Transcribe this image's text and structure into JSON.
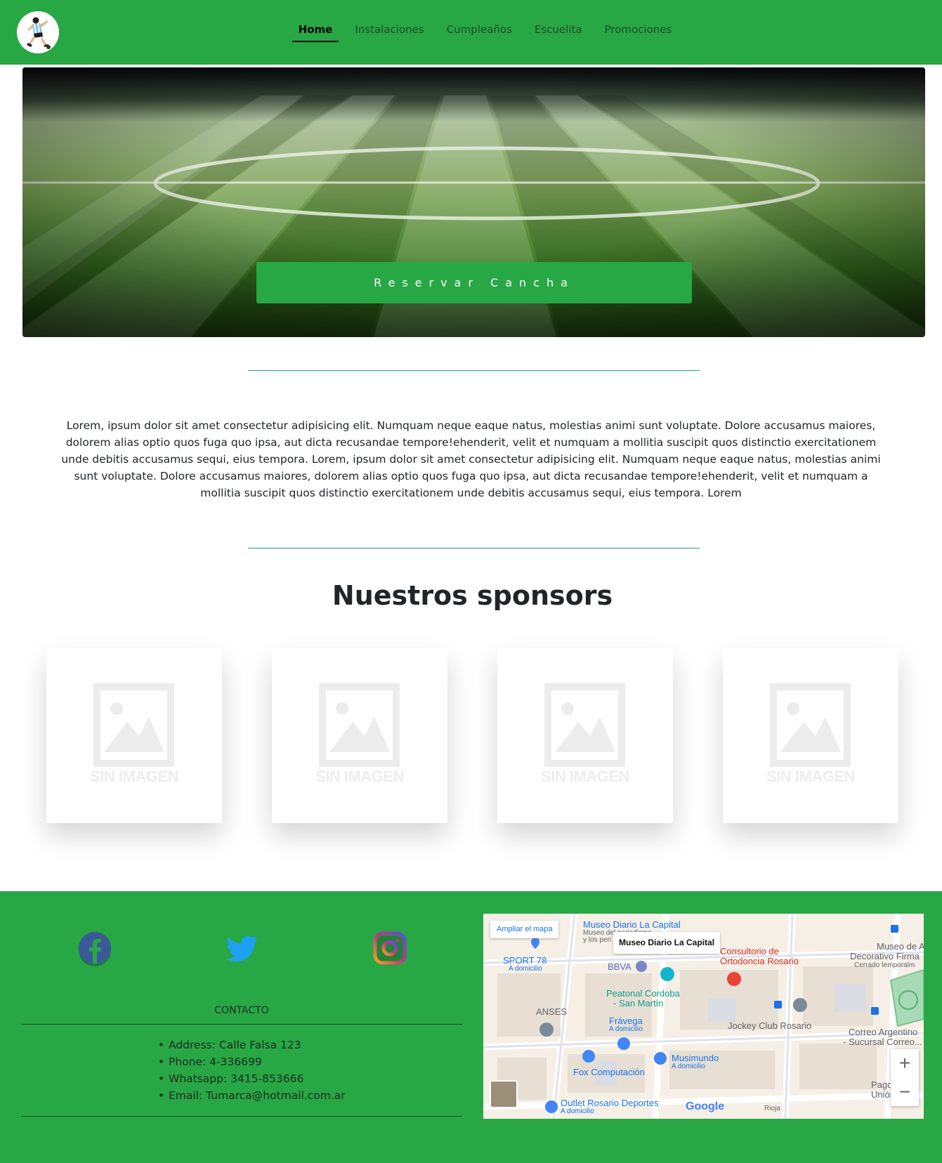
{
  "nav": {
    "items": [
      {
        "label": "Home",
        "active": true
      },
      {
        "label": "Instalaciones",
        "active": false
      },
      {
        "label": "Cumpleaños",
        "active": false
      },
      {
        "label": "Escuelita",
        "active": false
      },
      {
        "label": "Promociones",
        "active": false
      }
    ]
  },
  "hero": {
    "button_label": "Reservar Cancha"
  },
  "intro": {
    "text": "Lorem, ipsum dolor sit amet consectetur adipisicing elit. Numquam neque eaque natus, molestias animi sunt voluptate. Dolore accusamus maiores, dolorem alias optio quos fuga quo ipsa, aut dicta recusandae tempore!ehenderit, velit et numquam a mollitia suscipit quos distinctio exercitationem unde debitis accusamus sequi, eius tempora. Lorem, ipsum dolor sit amet consectetur adipisicing elit. Numquam neque eaque natus, molestias animi sunt voluptate. Dolore accusamus maiores, dolorem alias optio quos fuga quo ipsa, aut dicta recusandae tempore!ehenderit, velit et numquam a mollitia suscipit quos distinctio exercitationem unde debitis accusamus sequi, eius tempora. Lorem"
  },
  "sponsors": {
    "title": "Nuestros sponsors",
    "placeholder_text": "SIN IMAGEN"
  },
  "footer": {
    "social": [
      "facebook-icon",
      "twitter-icon",
      "instagram-icon"
    ],
    "contact_title": "CONTACTO",
    "contact": {
      "address": "Address: Calle Falsa 123",
      "phone": "Phone: 4-336699",
      "whatsapp": "Whatsapp: 3415-853666",
      "email": "Email: Tumarca@hotmail.com.ar"
    }
  },
  "map": {
    "expand_label": "Ampliar el mapa",
    "place_card": "Museo Diario La Capital",
    "labels": {
      "museo_diario": "Museo Diario La Capital",
      "museo_diario_sub": "Museo del periodismo",
      "museo_diario_sub2": "y los peri",
      "sport78": "SPORT 78",
      "sport78_sub": "A domicilio",
      "bbva": "BBVA",
      "consultorio": "Consultorio de",
      "consultorio2": "Ortodoncia Rosario",
      "museo_decorativo": "Museo de A",
      "museo_decorativo2": "Decorativo Firma",
      "museo_decorativo_sub": "Cerrado temporalm",
      "peatonal": "Peatonal Cordoba",
      "peatonal2": "- San Martín",
      "anses": "ANSES",
      "fravega": "Frávega",
      "fravega_sub": "A domicilio",
      "jockey": "Jockey Club Rosario",
      "correo": "Correo Argentino",
      "correo2": "- Sucursal Correo...",
      "musimundo": "Musimundo",
      "musimundo_sub": "A domicilio",
      "fox": "Fox Computación",
      "outlet": "Outlet Rosario Deportes",
      "outlet_sub": "A domicilio",
      "pago": "Pago",
      "pago2": "Unión",
      "rioja": "Rioja"
    },
    "zoom_in": "+",
    "zoom_out": "−",
    "google": "Google"
  }
}
